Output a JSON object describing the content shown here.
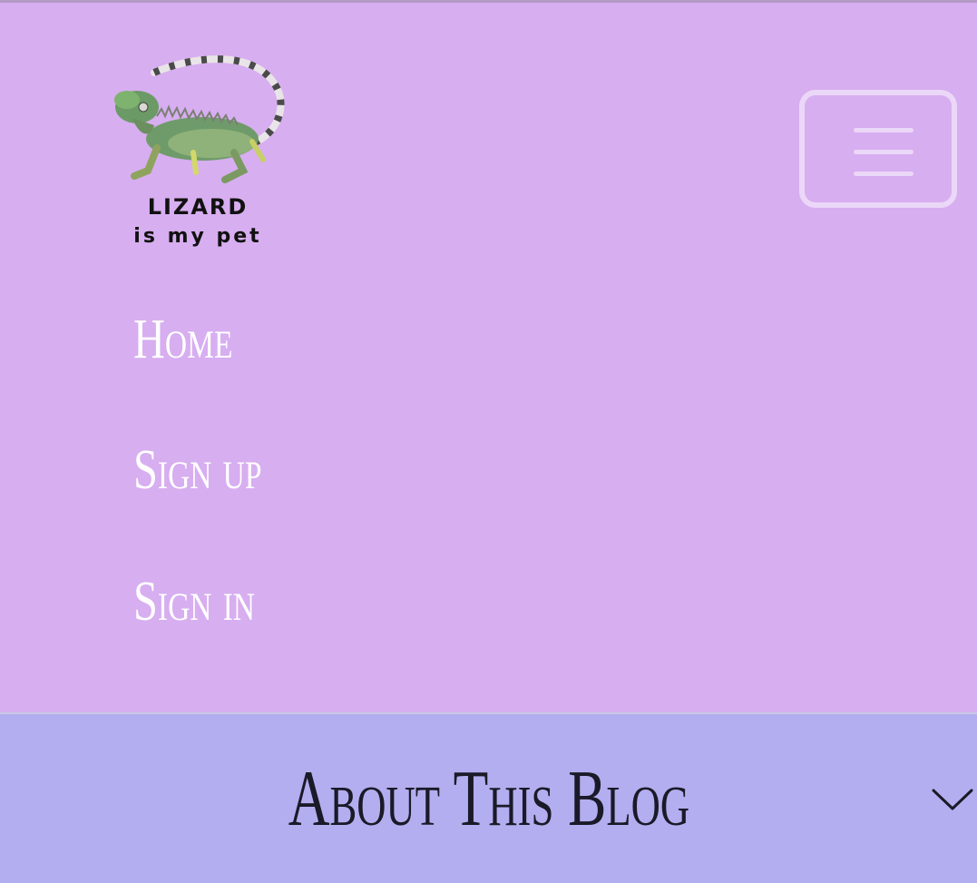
{
  "header": {
    "logo": {
      "line1": "LIZARD",
      "line2": "is my pet",
      "icon": "iguana-logo"
    },
    "menu_toggle": {
      "icon": "hamburger-menu-icon"
    },
    "nav": [
      {
        "label": "Home"
      },
      {
        "label": "Sign up"
      },
      {
        "label": "Sign in"
      }
    ]
  },
  "about": {
    "title": "About This Blog",
    "icon": "chevron-down-icon"
  },
  "colors": {
    "header_bg": "#d7aef0",
    "about_bg": "#b3aeef",
    "nav_text": "#ffffff",
    "menu_toggle": "#ebd7f7",
    "about_text": "#1a1a28"
  }
}
